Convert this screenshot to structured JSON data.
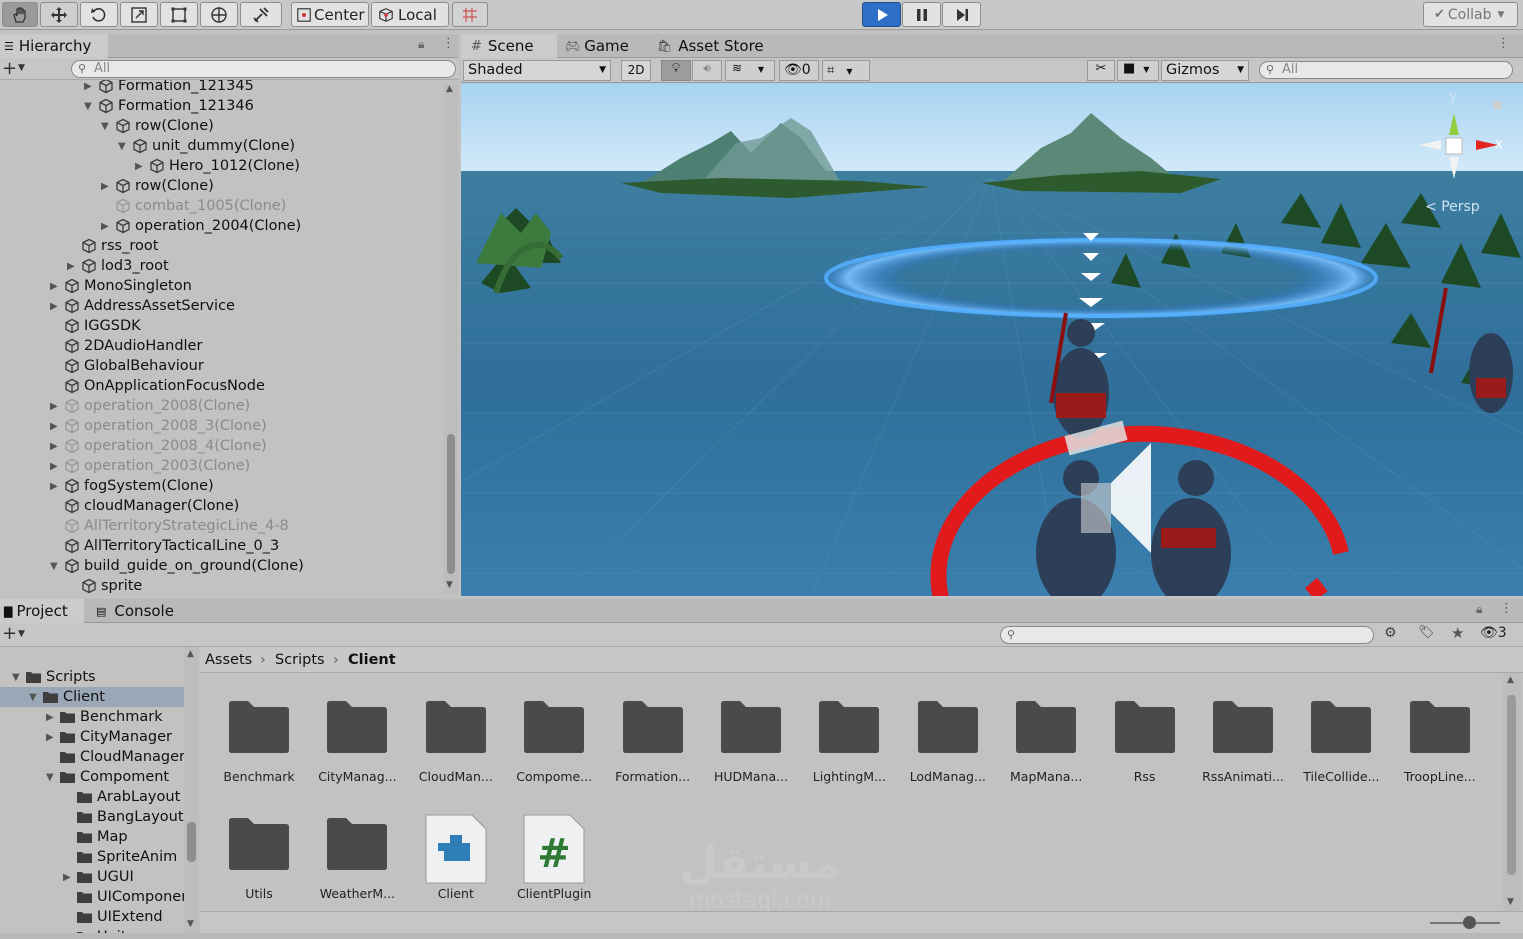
{
  "toolbar": {
    "center_label": "Center",
    "local_label": "Local",
    "collab_label": "Collab",
    "tools": [
      "hand-tool-icon",
      "move-tool-icon",
      "rotate-tool-icon",
      "scale-tool-icon",
      "rect-tool-icon",
      "transform-tool-icon",
      "custom-tool-icon"
    ]
  },
  "hierarchy": {
    "tab_label": "Hierarchy",
    "search_placeholder": "All",
    "items": [
      {
        "label": "Formation_121345",
        "indent": 5,
        "arrow": "right",
        "dim": false
      },
      {
        "label": "Formation_121346",
        "indent": 5,
        "arrow": "down",
        "dim": false
      },
      {
        "label": "row(Clone)",
        "indent": 6,
        "arrow": "down",
        "dim": false
      },
      {
        "label": "unit_dummy(Clone)",
        "indent": 7,
        "arrow": "down",
        "dim": false
      },
      {
        "label": "Hero_1012(Clone)",
        "indent": 8,
        "arrow": "right",
        "dim": false
      },
      {
        "label": "row(Clone)",
        "indent": 6,
        "arrow": "right",
        "dim": false
      },
      {
        "label": "combat_1005(Clone)",
        "indent": 6,
        "arrow": "",
        "dim": true
      },
      {
        "label": "operation_2004(Clone)",
        "indent": 6,
        "arrow": "right",
        "dim": false
      },
      {
        "label": "rss_root",
        "indent": 4,
        "arrow": "",
        "dim": false
      },
      {
        "label": "lod3_root",
        "indent": 4,
        "arrow": "right",
        "dim": false
      },
      {
        "label": "MonoSingleton",
        "indent": 3,
        "arrow": "right",
        "dim": false
      },
      {
        "label": "AddressAssetService",
        "indent": 3,
        "arrow": "right",
        "dim": false
      },
      {
        "label": "IGGSDK",
        "indent": 3,
        "arrow": "",
        "dim": false
      },
      {
        "label": "2DAudioHandler",
        "indent": 3,
        "arrow": "",
        "dim": false
      },
      {
        "label": "GlobalBehaviour",
        "indent": 3,
        "arrow": "",
        "dim": false
      },
      {
        "label": "OnApplicationFocusNode",
        "indent": 3,
        "arrow": "",
        "dim": false
      },
      {
        "label": "operation_2008(Clone)",
        "indent": 3,
        "arrow": "right",
        "dim": true
      },
      {
        "label": "operation_2008_3(Clone)",
        "indent": 3,
        "arrow": "right",
        "dim": true
      },
      {
        "label": "operation_2008_4(Clone)",
        "indent": 3,
        "arrow": "right",
        "dim": true
      },
      {
        "label": "operation_2003(Clone)",
        "indent": 3,
        "arrow": "right",
        "dim": true
      },
      {
        "label": "fogSystem(Clone)",
        "indent": 3,
        "arrow": "right",
        "dim": false
      },
      {
        "label": "cloudManager(Clone)",
        "indent": 3,
        "arrow": "",
        "dim": false
      },
      {
        "label": "AllTerritoryStrategicLine_4-8",
        "indent": 3,
        "arrow": "",
        "dim": true
      },
      {
        "label": "AllTerritoryTacticalLine_0_3",
        "indent": 3,
        "arrow": "",
        "dim": false
      },
      {
        "label": "build_guide_on_ground(Clone)",
        "indent": 3,
        "arrow": "down",
        "dim": false
      },
      {
        "label": "sprite",
        "indent": 4,
        "arrow": "",
        "dim": false
      }
    ]
  },
  "scene": {
    "tabs": [
      "Scene",
      "Game",
      "Asset Store"
    ],
    "shading_mode": "Shaded",
    "mode_2d_label": "2D",
    "hidden_count": "0",
    "gizmos_label": "Gizmos",
    "search_placeholder": "All",
    "persp_label": "Persp",
    "axis_y": "y",
    "axis_x": "x"
  },
  "bottom": {
    "tabs": [
      "Project",
      "Console"
    ],
    "hidden_count": "3",
    "breadcrumb": [
      "Assets",
      "Scripts",
      "Client"
    ],
    "tree": [
      {
        "label": "Scripts",
        "indent": 1,
        "arrow": "down",
        "selected": false
      },
      {
        "label": "Client",
        "indent": 2,
        "arrow": "down",
        "selected": true
      },
      {
        "label": "Benchmark",
        "indent": 3,
        "arrow": "right",
        "selected": false
      },
      {
        "label": "CityManager",
        "indent": 3,
        "arrow": "right",
        "selected": false
      },
      {
        "label": "CloudManager",
        "indent": 3,
        "arrow": "",
        "selected": false
      },
      {
        "label": "Compoment",
        "indent": 3,
        "arrow": "down",
        "selected": false
      },
      {
        "label": "ArabLayout",
        "indent": 4,
        "arrow": "",
        "selected": false
      },
      {
        "label": "BangLayout",
        "indent": 4,
        "arrow": "",
        "selected": false
      },
      {
        "label": "Map",
        "indent": 4,
        "arrow": "",
        "selected": false
      },
      {
        "label": "SpriteAnim",
        "indent": 4,
        "arrow": "",
        "selected": false
      },
      {
        "label": "UGUI",
        "indent": 4,
        "arrow": "right",
        "selected": false
      },
      {
        "label": "UIComponent",
        "indent": 4,
        "arrow": "",
        "selected": false
      },
      {
        "label": "UIExtend",
        "indent": 4,
        "arrow": "",
        "selected": false
      },
      {
        "label": "Unit",
        "indent": 4,
        "arrow": "",
        "selected": false
      }
    ],
    "assets": [
      {
        "label": "Benchmark",
        "type": "folder"
      },
      {
        "label": "CityManag...",
        "type": "folder"
      },
      {
        "label": "CloudMan...",
        "type": "folder"
      },
      {
        "label": "Compome...",
        "type": "folder"
      },
      {
        "label": "Formation...",
        "type": "folder"
      },
      {
        "label": "HUDMana...",
        "type": "folder"
      },
      {
        "label": "LightingM...",
        "type": "folder"
      },
      {
        "label": "LodManag...",
        "type": "folder"
      },
      {
        "label": "MapMana...",
        "type": "folder"
      },
      {
        "label": "Rss",
        "type": "folder"
      },
      {
        "label": "RssAnimati...",
        "type": "folder"
      },
      {
        "label": "TileCollide...",
        "type": "folder"
      },
      {
        "label": "TroopLine...",
        "type": "folder"
      },
      {
        "label": "Utils",
        "type": "folder"
      },
      {
        "label": "WeatherM...",
        "type": "folder"
      },
      {
        "label": "Client",
        "type": "assembly"
      },
      {
        "label": "ClientPlugin",
        "type": "csharp"
      }
    ],
    "zoom_fraction": 0.55
  },
  "watermark": {
    "line1": "مستقل",
    "line2": "mostaql.com"
  },
  "colors": {
    "play_blue": "#2d6fc7",
    "folder": "#4a4a4a",
    "selection": "#9aa7b7"
  }
}
